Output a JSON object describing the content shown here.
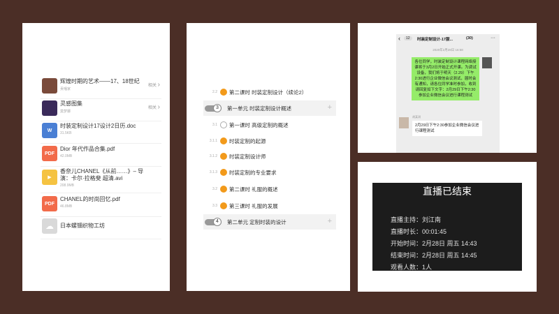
{
  "files": [
    {
      "title": "辉煌时期的艺术——17、18世纪",
      "sub": "贡嘎家",
      "related": "相关 ",
      "arrow": "›",
      "icon": "image-icon",
      "color": "#7a4a3a"
    },
    {
      "title": "灵感图集",
      "sub": "莫梦娜",
      "related": "相关 ",
      "arrow": "›",
      "icon": "image-icon",
      "color": "#3a2a5a"
    },
    {
      "title": "时装定制设计17设计2日历.doc",
      "sub": "31.5KB",
      "icon": "doc-icon",
      "icon_text": "W",
      "color": "#4a7fd4"
    },
    {
      "title": "Dior 年代作品合集.pdf",
      "sub": "42.0MB",
      "icon": "pdf-icon",
      "icon_text": "PDF",
      "color": "#f26b4a"
    },
    {
      "title": "香奈儿CHANEL《从前……》– 导演：卡尔·拉格斐 超清.avi",
      "sub": "208.9MB",
      "icon": "video-icon",
      "icon_text": "▶",
      "color": "#f5c342"
    },
    {
      "title": "CHANEL的时尚回忆.pdf",
      "sub": "46.8MB",
      "icon": "pdf-icon",
      "icon_text": "PDF",
      "color": "#f26b4a"
    },
    {
      "title": "日本螺钿织物工坊",
      "sub": "",
      "icon": "cloud-icon",
      "icon_text": "☁",
      "color": "#d9d9d9"
    }
  ],
  "outline": [
    {
      "num": "2.2",
      "text": "第二课时 时装定制设计（续论2）",
      "kind": "dot"
    },
    {
      "unit_num": "3",
      "text": "第一单元 时装定制设计概述",
      "kind": "unit",
      "plus": "+"
    },
    {
      "num": "3.1",
      "text": "第一课时   高级定制的概述",
      "kind": "empty"
    },
    {
      "num": "3.1.1",
      "text": "时装定制的起源",
      "kind": "dot"
    },
    {
      "num": "3.1.2",
      "text": "时装定制设计师",
      "kind": "dot"
    },
    {
      "num": "3.1.3",
      "text": "时装定制的专业要求",
      "kind": "dot"
    },
    {
      "num": "3.2",
      "text": "第二课时   礼服的概述",
      "kind": "dot"
    },
    {
      "num": "3.3",
      "text": "第三课时   礼服的发展",
      "kind": "dot"
    },
    {
      "unit_num": "4",
      "text": "第二单元 定制时装的设计",
      "kind": "unit",
      "plus": "+"
    }
  ],
  "chat": {
    "badge": "12",
    "back": "‹",
    "title": "时装定制设计-17服...",
    "count": "(30)",
    "more": "···",
    "time": "2020年2月28日 16:58",
    "message_green": "各位同学，时装定制设计课程网络授课将于3月2日开始正式开课。为调试设备，我们将于明天（2.29）下午2:30进行企业微信会议测试，届时会有通知，请各位同学准时参加，收到请回复如下文字：2月29日下午2:30参加企业微信会议进行课程测试",
    "sender": "胡某琪",
    "message_white": "2月29日下午2:30参加企业微信会议进行课程测试"
  },
  "live": {
    "title": "直播已结束",
    "rows": [
      {
        "label": "直播主持：",
        "value": "刘江南"
      },
      {
        "label": "直播时长：",
        "value": "00:01:45"
      },
      {
        "label": "开始时间：",
        "value": "2月28日 周五 14:43"
      },
      {
        "label": "结束时间：",
        "value": "2月28日 周五 14:45"
      },
      {
        "label": "观看人数：",
        "value": "1人"
      }
    ]
  }
}
